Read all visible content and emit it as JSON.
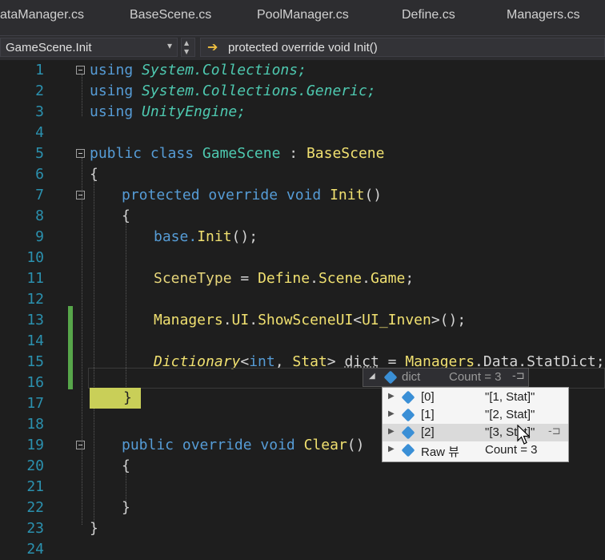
{
  "tabs": [
    "ataManager.cs",
    "BaseScene.cs",
    "PoolManager.cs",
    "Define.cs",
    "Managers.cs"
  ],
  "nav": {
    "left": "GameScene.Init",
    "right": "protected override void Init()"
  },
  "line_numbers": [
    "1",
    "2",
    "3",
    "4",
    "5",
    "6",
    "7",
    "8",
    "9",
    "10",
    "11",
    "12",
    "13",
    "14",
    "15",
    "16",
    "17",
    "18",
    "19",
    "20",
    "21",
    "22",
    "23",
    "24"
  ],
  "code": {
    "l1": {
      "kw": "using",
      "ns": "System.Collections;"
    },
    "l2": {
      "kw": "using",
      "ns": "System.Collections.Generic;"
    },
    "l3": {
      "kw": "using",
      "ns": "UnityEngine;"
    },
    "l5": {
      "kw": "public class",
      "cls": "GameScene",
      "sep": " : ",
      "base": "BaseScene"
    },
    "l6": "{",
    "l7": {
      "kw": "protected override void",
      "name": "Init",
      "rest": "()"
    },
    "l8": "{",
    "l9": {
      "a": "base.",
      "b": "Init",
      "c": "();"
    },
    "l11": {
      "a": "SceneType",
      "b": " = ",
      "c": "Define",
      "d": ".",
      "e": "Scene",
      "f": ".",
      "g": "Game",
      "h": ";"
    },
    "l13": {
      "a": "Managers",
      "b": ".",
      "c": "UI",
      "d": ".",
      "e": "ShowSceneUI",
      "f": "<",
      "g": "UI_Inven",
      "h": ">();"
    },
    "l15": {
      "a": "Dictionary",
      "b": "<",
      "c": "int",
      "d": ", ",
      "e": "Stat",
      "f": "> ",
      "g": "dict",
      "h": " = ",
      "i": "Managers",
      "j": ".Data.StatDict;"
    },
    "l17": "}",
    "l19": {
      "kw": "public override void",
      "name": "Clear",
      "rest": "()"
    },
    "l20": "{",
    "l22": "}",
    "l23": "}"
  },
  "datatip": {
    "name": "dict",
    "count": "Count = 3",
    "rows": [
      {
        "name": "[0]",
        "value": "\"[1, Stat]\""
      },
      {
        "name": "[1]",
        "value": "\"[2, Stat]\""
      },
      {
        "name": "[2]",
        "value": "\"[3, Stat]\""
      },
      {
        "name": "Raw 뷰",
        "value": "Count = 3"
      }
    ]
  }
}
